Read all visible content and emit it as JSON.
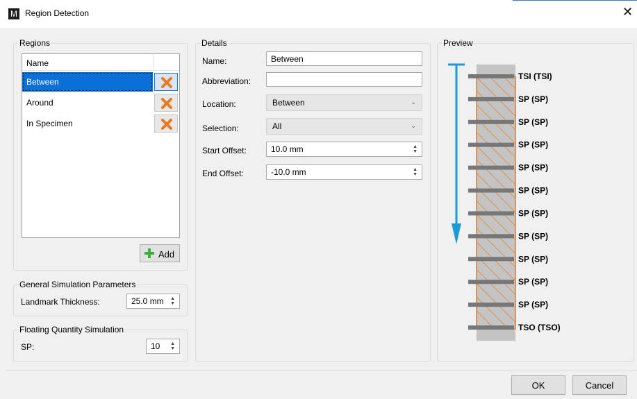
{
  "window": {
    "title": "Region Detection",
    "app_icon_letter": "M",
    "close_glyph": "✕"
  },
  "regions": {
    "group_title": "Regions",
    "column_header": "Name",
    "items": [
      {
        "name": "Between",
        "selected": true
      },
      {
        "name": "Around",
        "selected": false
      },
      {
        "name": "In Specimen",
        "selected": false
      }
    ],
    "add_label": "Add"
  },
  "general_sim": {
    "group_title": "General Simulation Parameters",
    "landmark_label": "Landmark Thickness:",
    "landmark_value": "25.0 mm"
  },
  "floating_sim": {
    "group_title": "Floating Quantity Simulation",
    "sp_label": "SP:",
    "sp_value": "10"
  },
  "details": {
    "group_title": "Details",
    "name_label": "Name:",
    "name_value": "Between",
    "abbr_label": "Abbreviation:",
    "abbr_value": "",
    "location_label": "Location:",
    "location_value": "Between",
    "selection_label": "Selection:",
    "selection_value": "All",
    "start_label": "Start Offset:",
    "start_value": "10.0 mm",
    "end_label": "End Offset:",
    "end_value": "-10.0 mm"
  },
  "preview": {
    "group_title": "Preview",
    "landmarks": [
      "TSI (TSI)",
      "SP (SP)",
      "SP (SP)",
      "SP (SP)",
      "SP (SP)",
      "SP (SP)",
      "SP (SP)",
      "SP (SP)",
      "SP (SP)",
      "SP (SP)",
      "SP (SP)",
      "TSO (TSO)"
    ],
    "colors": {
      "arrow": "#1a9bd6",
      "region": "#e07b22",
      "specimen": "#c4c4c4",
      "landmark": "#777777"
    }
  },
  "footer": {
    "ok_label": "OK",
    "cancel_label": "Cancel"
  },
  "icons": {
    "delete": "orange-x-icon",
    "add": "green-plus-icon",
    "spin": "spin-arrows-icon",
    "dropdown": "chevron-down-icon"
  }
}
